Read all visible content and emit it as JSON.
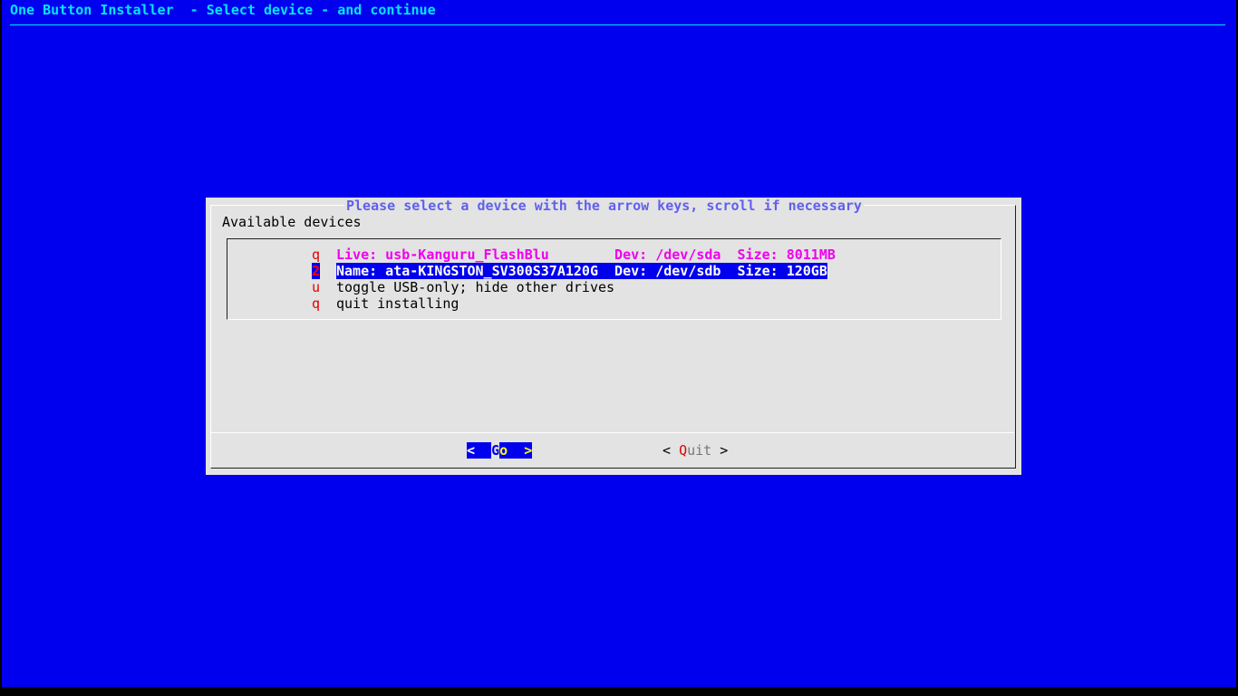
{
  "header": {
    "title": "One Button Installer  - Select device - and continue"
  },
  "dialog": {
    "heading": "Please select a device with the arrow keys, scroll if necessary",
    "label": "Available devices",
    "items": [
      {
        "key": "q",
        "text": "Live: usb-Kanguru_FlashBlu        Dev: /dev/sda  Size: 8011MB",
        "style": "live"
      },
      {
        "key": "2",
        "text": "Name: ata-KINGSTON_SV300S37A120G  Dev: /dev/sdb  Size: 120GB",
        "style": "sel"
      },
      {
        "key": "u",
        "text": "toggle USB-only; hide other drives",
        "style": "plain"
      },
      {
        "key": "q",
        "text": "quit installing",
        "style": "plain"
      }
    ],
    "buttons": {
      "go_open": "<  ",
      "go_g": "G",
      "go_rest": "o  >",
      "quit_open": "< ",
      "quit_q": "Q",
      "quit_rest": "uit",
      "quit_close": " >"
    }
  }
}
